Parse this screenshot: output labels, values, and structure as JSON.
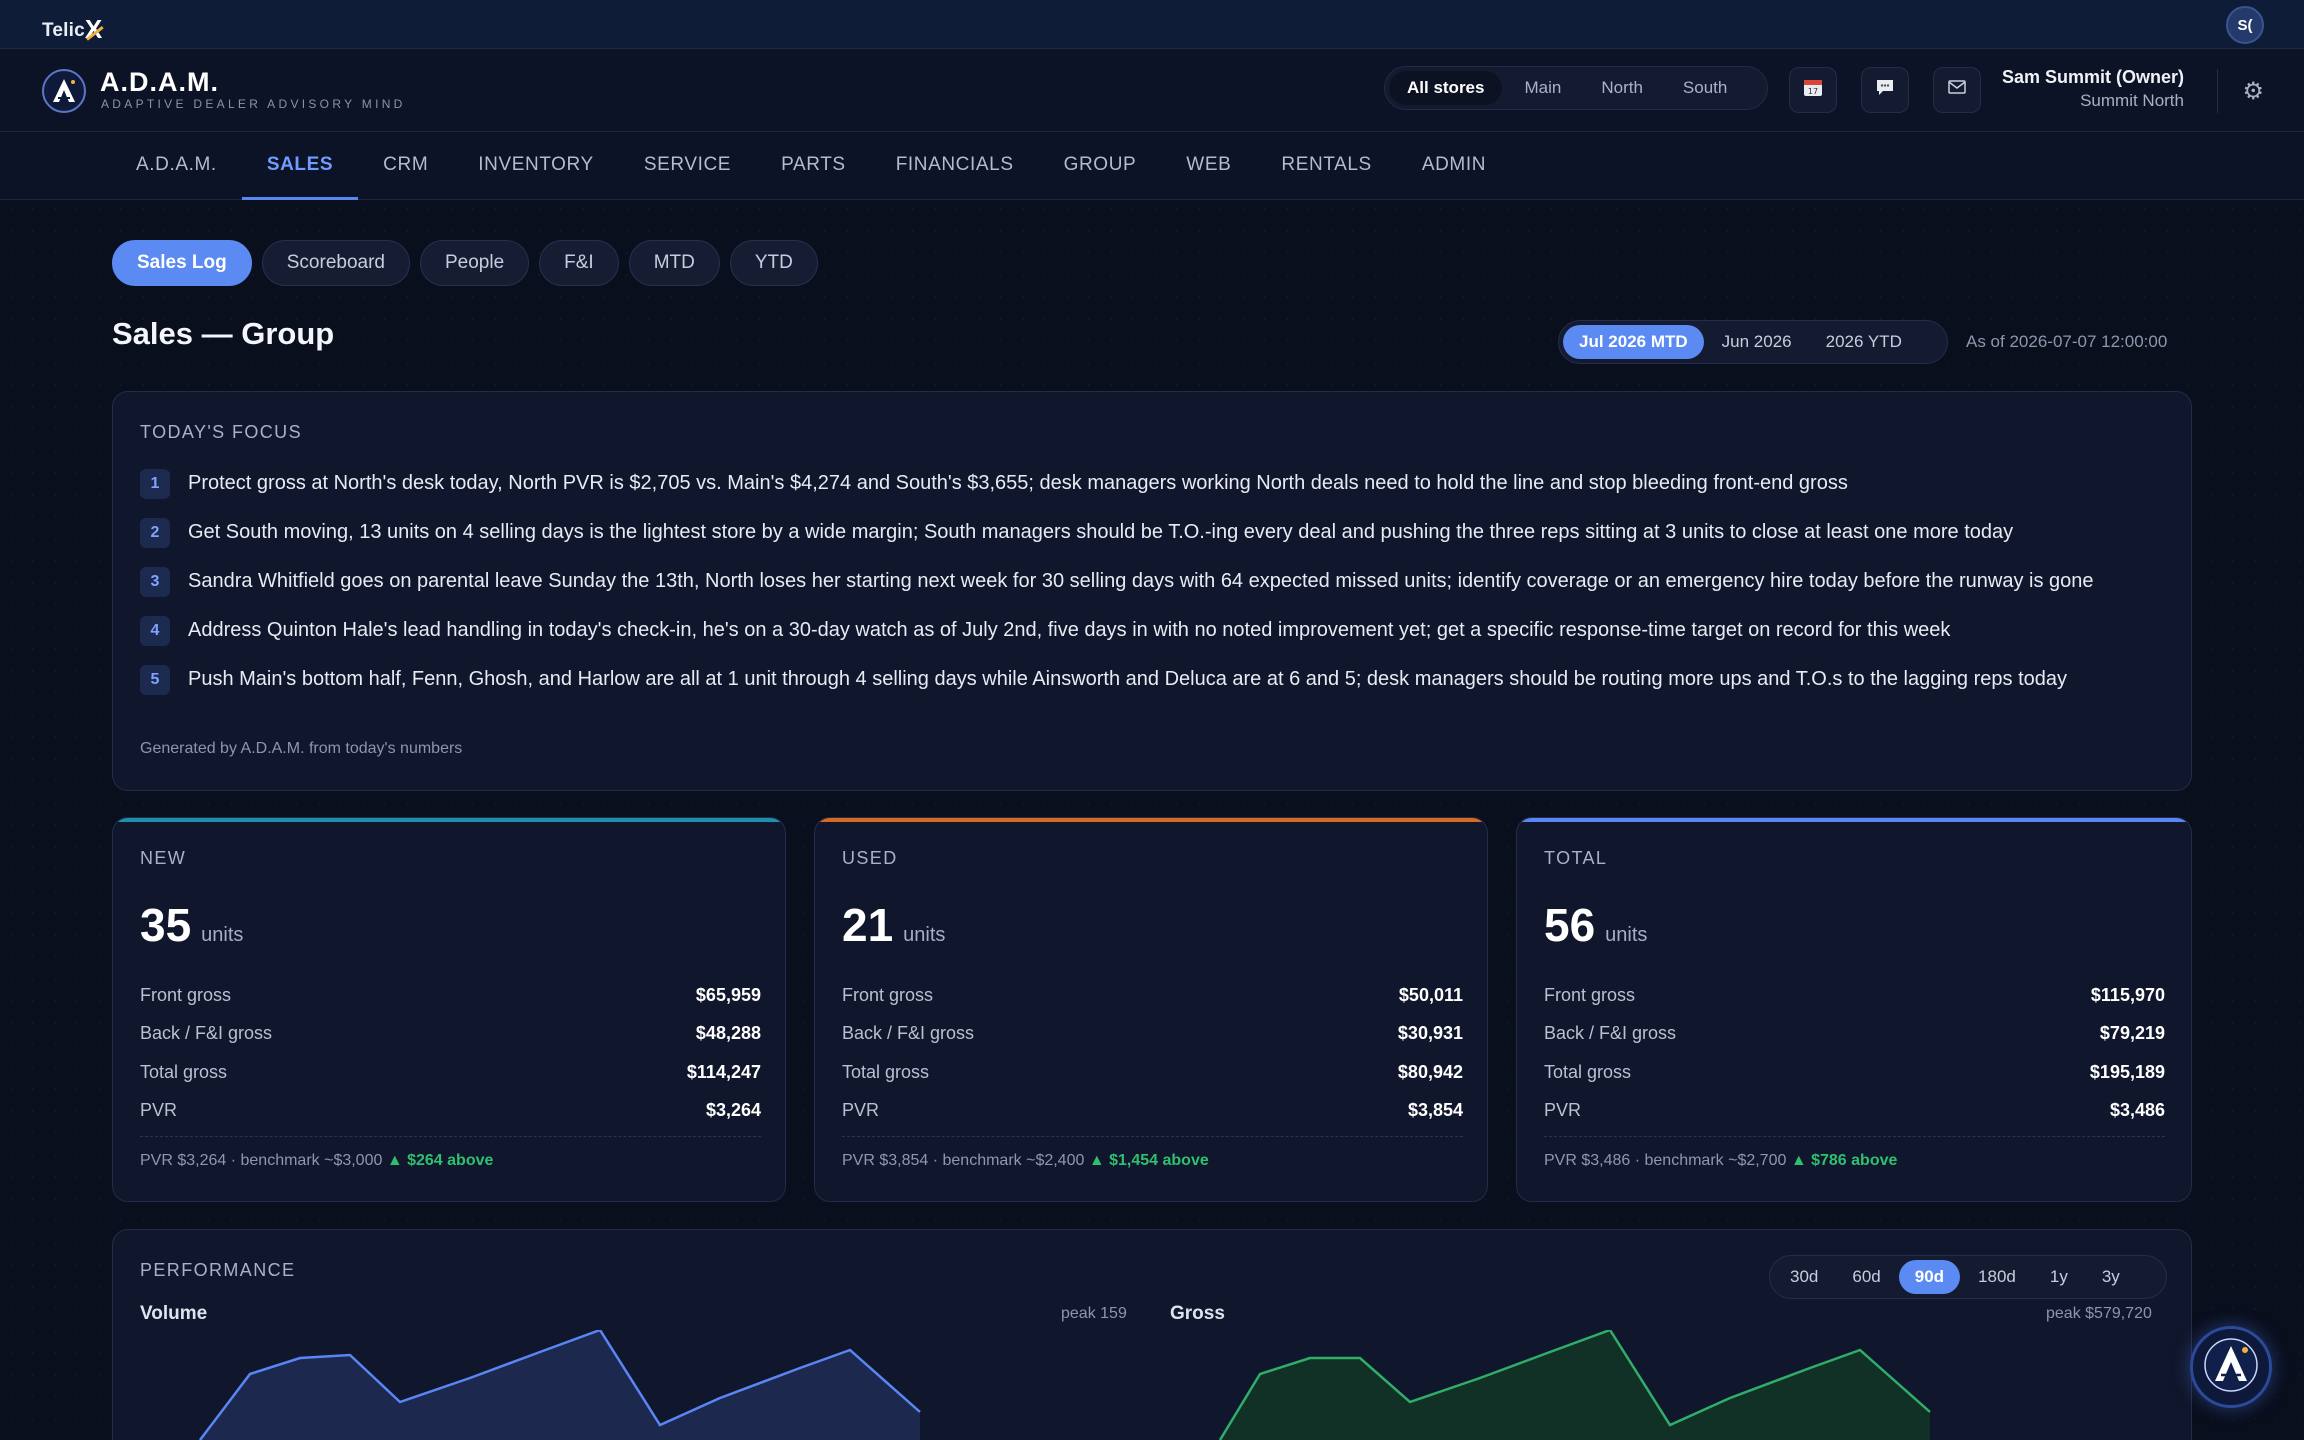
{
  "topbar": {
    "logo_text": "Telic",
    "logo_x": "X",
    "avatar_initials": "S("
  },
  "header": {
    "brand_title": "A.D.A.M.",
    "brand_subtitle": "ADAPTIVE DEALER ADVISORY MIND",
    "stores": [
      "All stores",
      "Main",
      "North",
      "South"
    ],
    "active_store": "All stores",
    "user_name": "Sam Summit (Owner)",
    "user_store": "Summit North",
    "icons": [
      "calendar-icon",
      "chat-icon",
      "mail-icon",
      "gear-icon"
    ]
  },
  "nav": {
    "items": [
      "A.D.A.M.",
      "SALES",
      "CRM",
      "INVENTORY",
      "SERVICE",
      "PARTS",
      "FINANCIALS",
      "GROUP",
      "WEB",
      "RENTALS",
      "ADMIN"
    ],
    "active": "SALES"
  },
  "subtabs": {
    "items": [
      "Sales Log",
      "Scoreboard",
      "People",
      "F&I",
      "MTD",
      "YTD"
    ],
    "active": "Sales Log"
  },
  "page": {
    "title": "Sales — Group",
    "periods": [
      "Jul 2026 MTD",
      "Jun 2026",
      "2026 YTD"
    ],
    "active_period": "Jul 2026 MTD",
    "as_of": "As of 2026-07-07 12:00:00"
  },
  "focus": {
    "label": "TODAY'S FOCUS",
    "items": [
      {
        "n": "1",
        "text": "Protect gross at North's desk today, North PVR is $2,705 vs. Main's $4,274 and South's $3,655; desk managers working North deals need to hold the line and stop bleeding front-end gross"
      },
      {
        "n": "2",
        "text": "Get South moving, 13 units on 4 selling days is the lightest store by a wide margin; South managers should be T.O.-ing every deal and pushing the three reps sitting at 3 units to close at least one more today"
      },
      {
        "n": "3",
        "text": "Sandra Whitfield goes on parental leave Sunday the 13th, North loses her starting next week for 30 selling days with 64 expected missed units; identify coverage or an emergency hire today before the runway is gone"
      },
      {
        "n": "4",
        "text": "Address Quinton Hale's lead handling in today's check-in, he's on a 30-day watch as of July 2nd, five days in with no noted improvement yet; get a specific response-time target on record for this week"
      },
      {
        "n": "5",
        "text": "Push Main's bottom half, Fenn, Ghosh, and Harlow are all at 1 unit through 4 selling days while Ainsworth and Deluca are at 6 and 5; desk managers should be routing more ups and T.O.s to the lagging reps today"
      }
    ],
    "footer": "Generated by A.D.A.M. from today's numbers"
  },
  "kpis": [
    {
      "label": "NEW",
      "units": "35",
      "units_label": "units",
      "accent": "#1f8fb0",
      "rows": [
        {
          "k": "Front gross",
          "v": "$65,959"
        },
        {
          "k": "Back / F&I gross",
          "v": "$48,288"
        },
        {
          "k": "Total gross",
          "v": "$114,247"
        },
        {
          "k": "PVR",
          "v": "$3,264"
        }
      ],
      "foot": "PVR $3,264 · benchmark ~$3,000",
      "delta": "▲ $264 above"
    },
    {
      "label": "USED",
      "units": "21",
      "units_label": "units",
      "accent": "#d9691f",
      "rows": [
        {
          "k": "Front gross",
          "v": "$50,011"
        },
        {
          "k": "Back / F&I gross",
          "v": "$30,931"
        },
        {
          "k": "Total gross",
          "v": "$80,942"
        },
        {
          "k": "PVR",
          "v": "$3,854"
        }
      ],
      "foot": "PVR $3,854 · benchmark ~$2,400",
      "delta": "▲ $1,454 above"
    },
    {
      "label": "TOTAL",
      "units": "56",
      "units_label": "units",
      "accent": "#5a86f5",
      "rows": [
        {
          "k": "Front gross",
          "v": "$115,970"
        },
        {
          "k": "Back / F&I gross",
          "v": "$79,219"
        },
        {
          "k": "Total gross",
          "v": "$195,189"
        },
        {
          "k": "PVR",
          "v": "$3,486"
        }
      ],
      "foot": "PVR $3,486 · benchmark ~$2,700",
      "delta": "▲ $786 above"
    }
  ],
  "performance": {
    "label": "PERFORMANCE",
    "ranges": [
      "30d",
      "60d",
      "90d",
      "180d",
      "1y",
      "3y"
    ],
    "active_range": "90d",
    "volume_title": "Volume",
    "volume_peak": "peak 159",
    "gross_title": "Gross",
    "gross_peak": "peak $579,720",
    "volume_color": "#5a86f5",
    "gross_color": "#2fae6a"
  }
}
